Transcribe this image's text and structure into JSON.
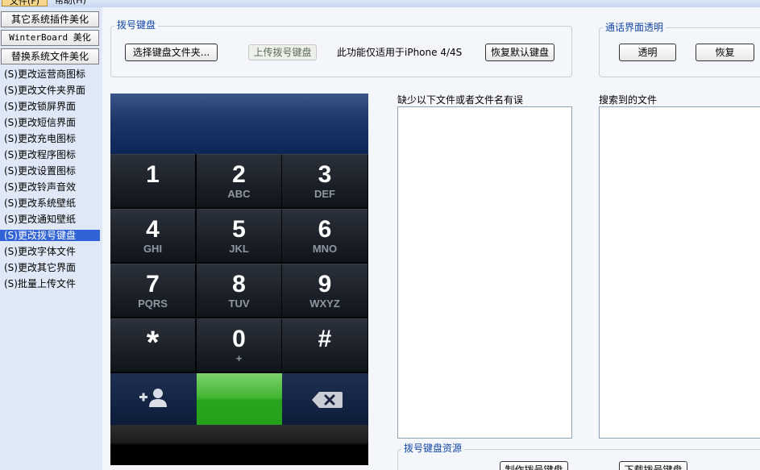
{
  "menu": {
    "file": "文件(F)",
    "help": "帮助(H)"
  },
  "sidebar": {
    "buttons": [
      "其它系统插件美化",
      "WinterBoard 美化",
      "替换系统文件美化"
    ],
    "items": [
      "(S)更改运营商图标",
      "(S)更改文件夹界面",
      "(S)更改锁屏界面",
      "(S)更改短信界面",
      "(S)更改充电图标",
      "(S)更改程序图标",
      "(S)更改设置图标",
      "(S)更改铃声音效",
      "(S)更改系统壁纸",
      "(S)更改通知壁纸",
      "(S)更改拨号键盘",
      "(S)更改字体文件",
      "(S)更改其它界面",
      "(S)批量上传文件"
    ],
    "selected_index": 10
  },
  "dial_group": {
    "title": "拨号键盘",
    "choose_folder": "选择键盘文件夹...",
    "upload": "上传拨号键盘",
    "note": "此功能仅适用于iPhone 4/4S",
    "restore_default": "恢复默认键盘"
  },
  "call_group": {
    "title": "通话界面透明",
    "transparent": "透明",
    "restore": "恢复"
  },
  "keypad": {
    "keys": [
      {
        "digit": "1",
        "letters": ""
      },
      {
        "digit": "2",
        "letters": "ABC"
      },
      {
        "digit": "3",
        "letters": "DEF"
      },
      {
        "digit": "4",
        "letters": "GHI"
      },
      {
        "digit": "5",
        "letters": "JKL"
      },
      {
        "digit": "6",
        "letters": "MNO"
      },
      {
        "digit": "7",
        "letters": "PQRS"
      },
      {
        "digit": "8",
        "letters": "TUV"
      },
      {
        "digit": "9",
        "letters": "WXYZ"
      },
      {
        "digit": "*",
        "letters": ""
      },
      {
        "digit": "0",
        "letters": "+"
      },
      {
        "digit": "#",
        "letters": ""
      }
    ]
  },
  "missing_files": {
    "label": "缺少以下文件或者文件名有误"
  },
  "found_files": {
    "label": "搜索到的文件"
  },
  "resource_group": {
    "title": "拨号键盘资源",
    "make": "制作拨号键盘",
    "download": "下载拨号键盘"
  },
  "colors": {
    "selection": "#3163d6",
    "group_title": "#1646a8",
    "call_green": "#2aa51e"
  }
}
